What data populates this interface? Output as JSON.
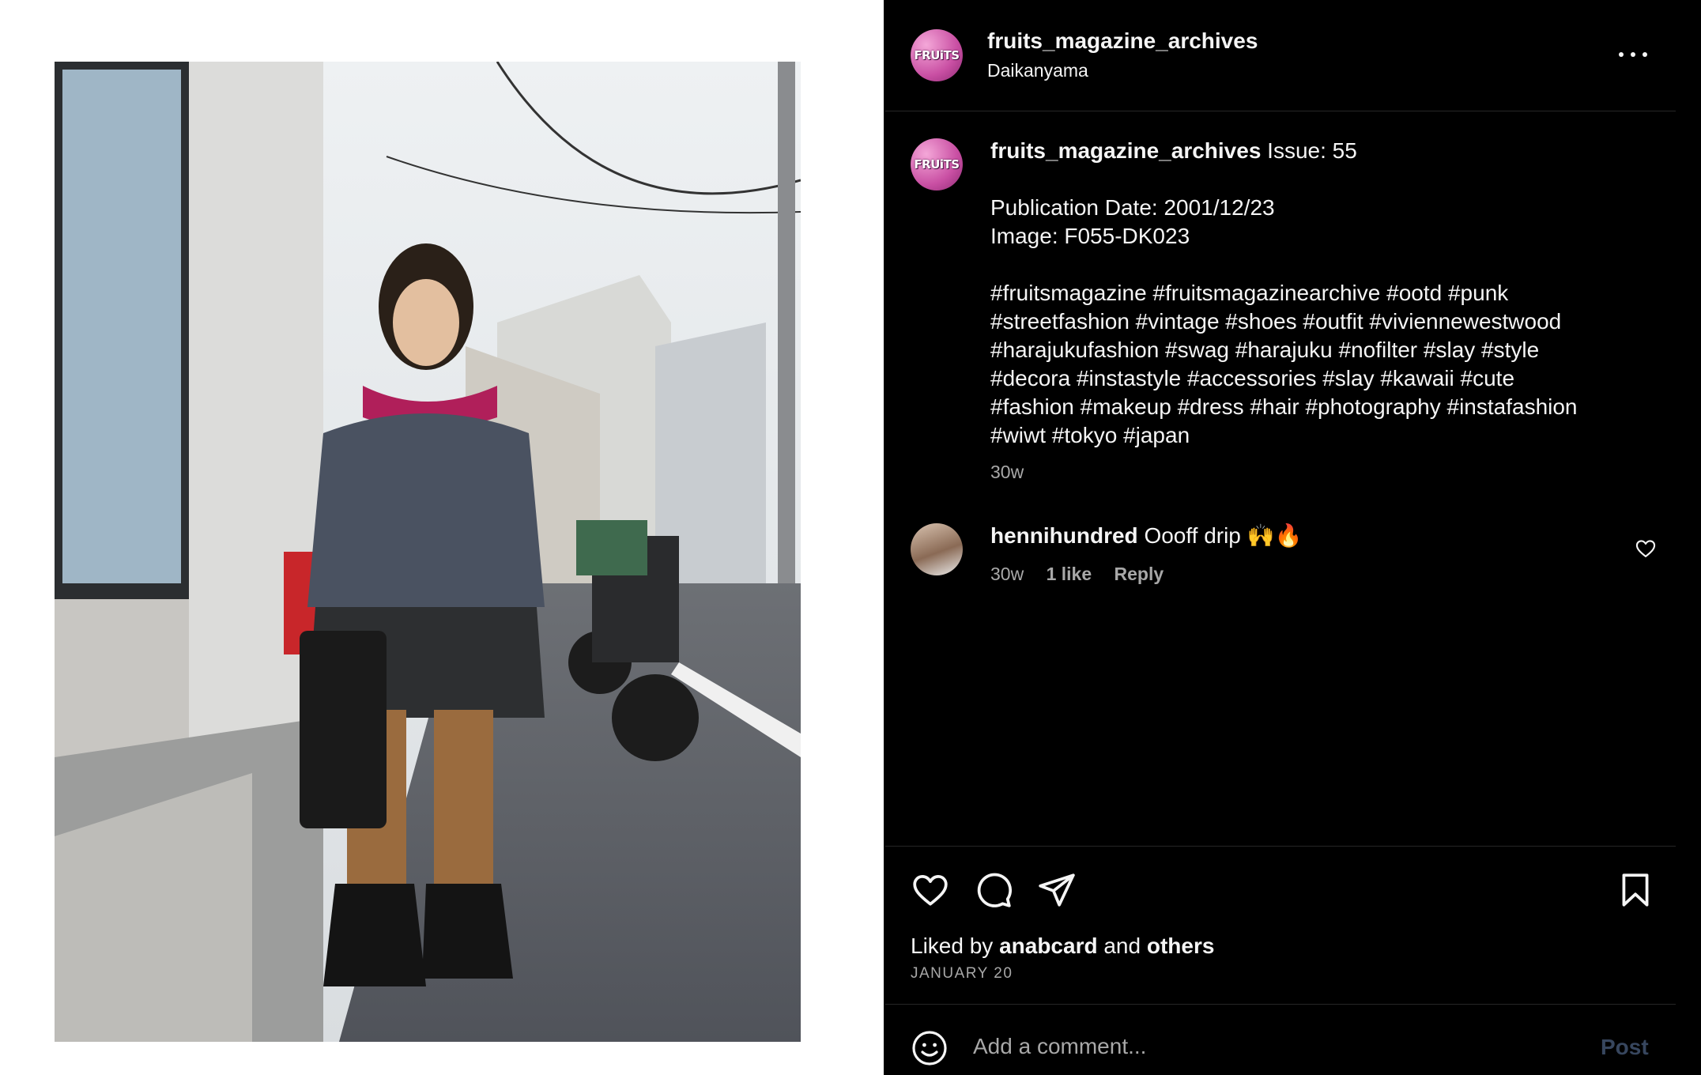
{
  "post": {
    "username": "fruits_magazine_archives",
    "location": "Daikanyama",
    "avatar_text": "FRUiTS"
  },
  "caption": {
    "username": "fruits_magazine_archives",
    "line1": "Issue: 55",
    "line2": "Publication Date: 2001/12/23",
    "line3": "Image: F055-DK023",
    "hashtags": [
      "#fruitsmagazine #fruitsmagazinearchive #ootd #punk",
      "#streetfashion #vintage #shoes #outfit #viviennewestwood",
      "#harajukufashion #swag #harajuku #nofilter #slay #style",
      "#decora #instastyle #accessories #slay #kawaii #cute",
      "#fashion #makeup #dress #hair #photography #instafashion",
      "#wiwt #tokyo #japan"
    ],
    "time": "30w"
  },
  "comment": {
    "username": "hennihundred",
    "text": "Oooff drip 🙌🔥",
    "time": "30w",
    "likes": "1 like",
    "reply": "Reply"
  },
  "likes": {
    "prefix": "Liked by",
    "user": "anabcard",
    "and": "and",
    "others": "others"
  },
  "date": "JANUARY 20",
  "add_comment": {
    "placeholder": "Add a comment...",
    "post_label": "Post"
  },
  "icons": {
    "more": "more-options-icon",
    "like": "heart-icon",
    "comment": "comment-icon",
    "share": "paper-plane-icon",
    "save": "bookmark-icon",
    "emoji": "smiley-icon"
  },
  "colors": {
    "background": "#000000",
    "text": "#f5f5f5",
    "muted": "#a8a8a8",
    "post_button": "#37465e"
  }
}
